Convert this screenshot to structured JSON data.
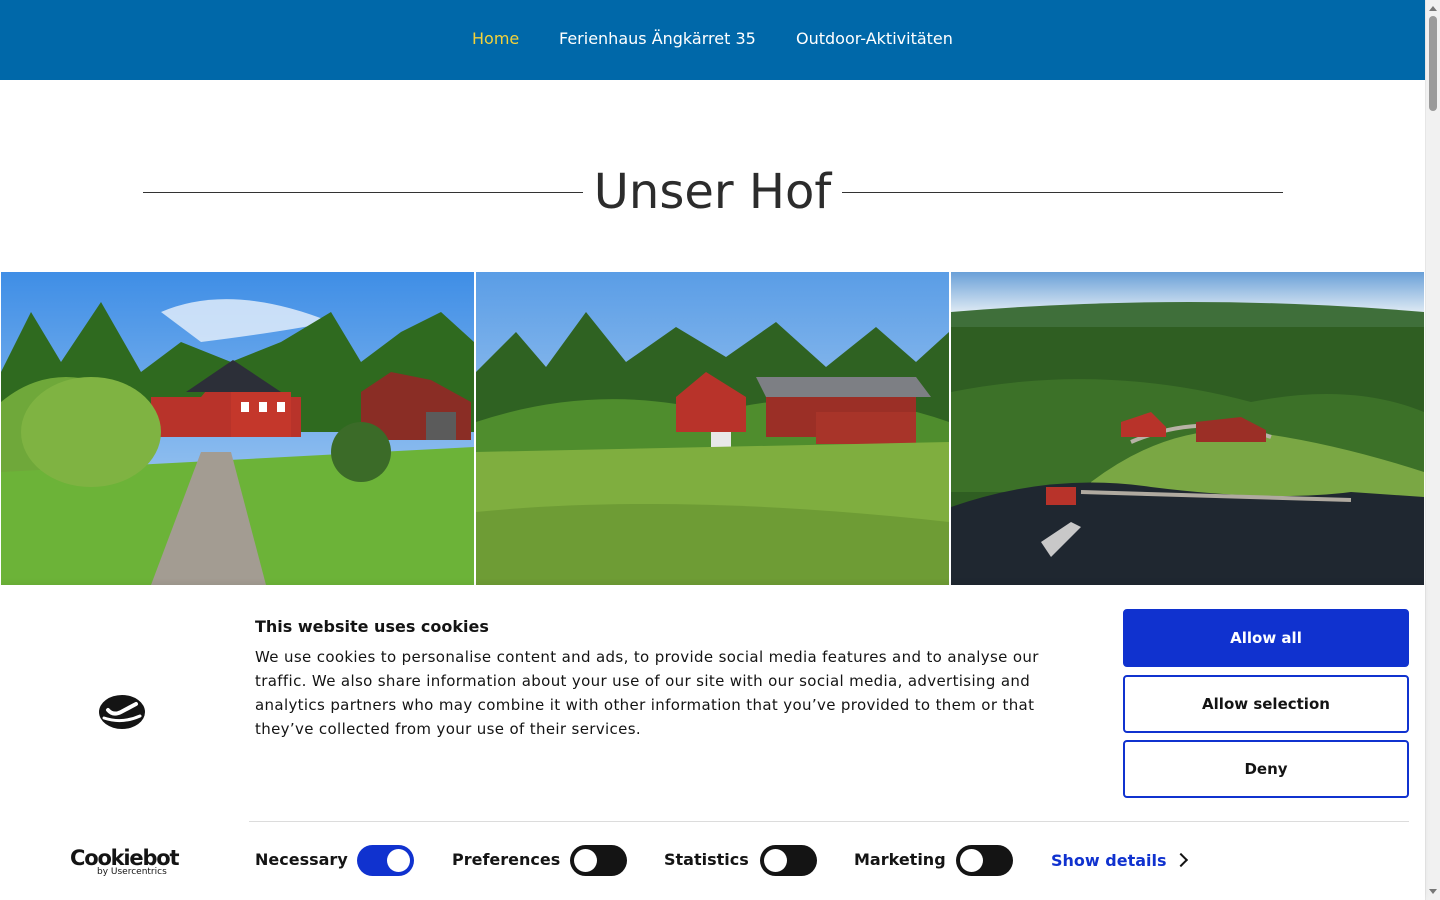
{
  "nav": {
    "items": [
      {
        "label": "Home",
        "active": true
      },
      {
        "label": "Ferienhaus Ängkärret 35",
        "active": false
      },
      {
        "label": "Outdoor-Aktivitäten",
        "active": false
      }
    ],
    "background": "#0068a9",
    "active_color": "#f3d23a"
  },
  "main": {
    "title": "Unser Hof"
  },
  "gallery": {
    "photos": [
      "farmhouse-driveway-photo",
      "farmyard-meadow-photo",
      "aerial-lake-farm-photo"
    ]
  },
  "cookie": {
    "heading": "This website uses cookies",
    "body": "We use cookies to personalise content and ads, to provide social media features and to analyse our traffic. We also share information about your use of our site with our social media, advertising and analytics partners who may combine it with other information that you’ve provided to them or that they’ve collected from your use of their services.",
    "buttons": {
      "allow_all": "Allow all",
      "allow_selection": "Allow selection",
      "deny": "Deny"
    },
    "categories": [
      {
        "label": "Necessary",
        "on": true
      },
      {
        "label": "Preferences",
        "on": false
      },
      {
        "label": "Statistics",
        "on": false
      },
      {
        "label": "Marketing",
        "on": false
      }
    ],
    "show_details": "Show details",
    "brand": {
      "name": "Cookiebot",
      "sub": "by Usercentrics"
    },
    "accent_color": "#1032cf"
  }
}
